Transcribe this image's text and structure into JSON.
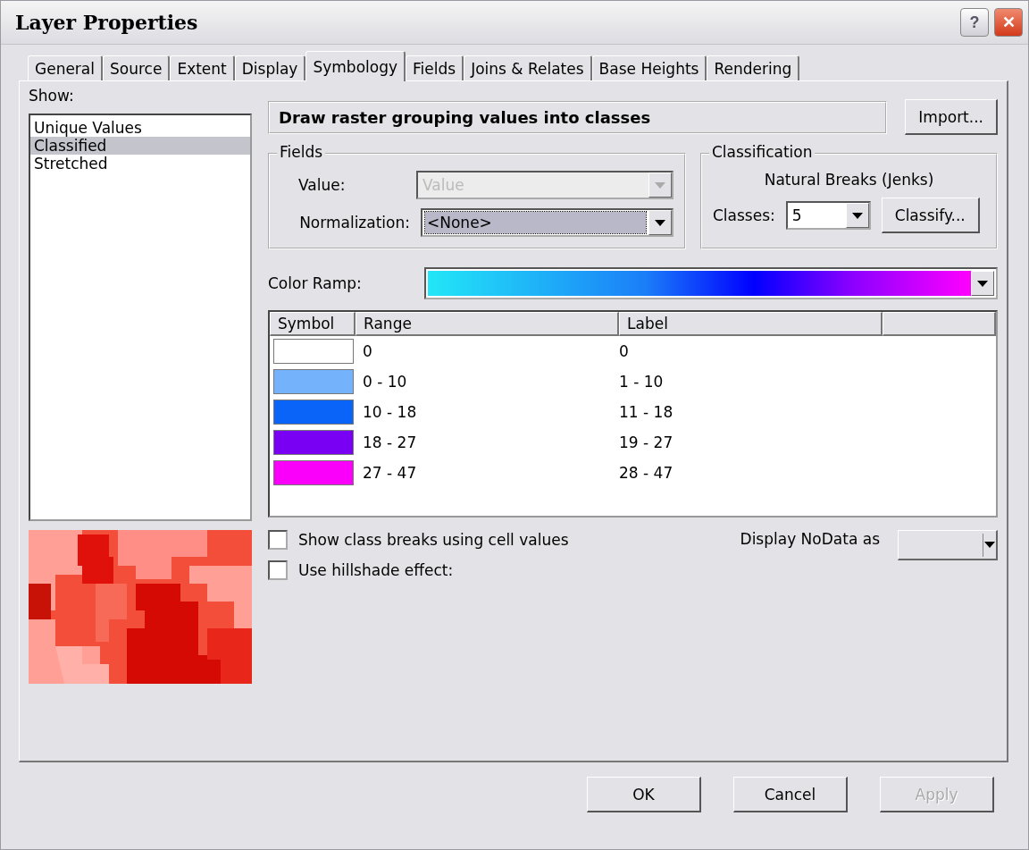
{
  "window": {
    "title": "Layer Properties",
    "buttons": [
      "?",
      "✕"
    ]
  },
  "tabs": [
    {
      "label": "General",
      "selected": false
    },
    {
      "label": "Source",
      "selected": false
    },
    {
      "label": "Extent",
      "selected": false
    },
    {
      "label": "Display",
      "selected": false
    },
    {
      "label": "Symbology",
      "selected": true
    },
    {
      "label": "Fields",
      "selected": false
    },
    {
      "label": "Joins & Relates",
      "selected": false
    },
    {
      "label": "Base Heights",
      "selected": false
    },
    {
      "label": "Rendering",
      "selected": false
    }
  ],
  "show": {
    "label": "Show:",
    "items": [
      {
        "label": "Unique Values",
        "selected": false
      },
      {
        "label": "Classified",
        "selected": true
      },
      {
        "label": "Stretched",
        "selected": false
      }
    ]
  },
  "heading": "Draw raster grouping values into classes",
  "import_button": "Import...",
  "fields": {
    "title": "Fields",
    "value_label": "Value:",
    "value": {
      "text": "Value",
      "disabled": true
    },
    "normalization_label": "Normalization:",
    "normalization": {
      "text": "<None>",
      "disabled": false
    }
  },
  "classification": {
    "title": "Classification",
    "method": "Natural Breaks (Jenks)",
    "classes_label": "Classes:",
    "classes": "5",
    "classify_button": "Classify..."
  },
  "color_ramp": {
    "label": "Color Ramp:"
  },
  "table": {
    "columns": [
      "Symbol",
      "Range",
      "Label"
    ],
    "rows": [
      {
        "color": "#ffffff",
        "range": "0",
        "label": "0"
      },
      {
        "color": "#74b2fb",
        "range": "0 - 10",
        "label": "1 - 10"
      },
      {
        "color": "#0a64f8",
        "range": "10 - 18",
        "label": "11 - 18"
      },
      {
        "color": "#7a00f4",
        "range": "18 - 27",
        "label": "19 - 27"
      },
      {
        "color": "#fa00fa",
        "range": "27 - 47",
        "label": "28 - 47"
      }
    ]
  },
  "options": [
    {
      "label": "Show class breaks using cell values",
      "checked": false
    },
    {
      "label": "Use hillshade effect:",
      "checked": false
    }
  ],
  "nodata_label": "Display NoData as",
  "buttons": [
    {
      "label": "OK",
      "disabled": false
    },
    {
      "label": "Cancel",
      "disabled": false
    },
    {
      "label": "Apply",
      "disabled": true
    }
  ]
}
